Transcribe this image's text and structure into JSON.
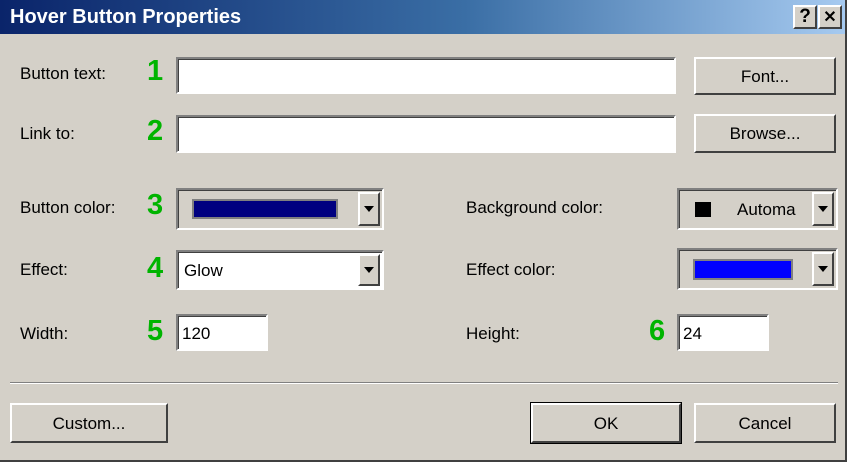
{
  "window": {
    "title": "Hover Button Properties",
    "help_label": "?",
    "close_label": "✕"
  },
  "fields": {
    "button_text": {
      "label": "Button text:",
      "number": "1",
      "value": ""
    },
    "link_to": {
      "label": "Link to:",
      "number": "2",
      "value": ""
    },
    "button_color": {
      "label": "Button color:",
      "number": "3",
      "color": "#000080"
    },
    "effect": {
      "label": "Effect:",
      "number": "4",
      "value": "Glow"
    },
    "width": {
      "label": "Width:",
      "number": "5",
      "value": "120"
    },
    "background_color": {
      "label": "Background color:",
      "value": "Automa",
      "color": "#000000"
    },
    "effect_color": {
      "label": "Effect color:",
      "color": "#0000ff"
    },
    "height": {
      "label": "Height:",
      "number": "6",
      "value": "24"
    }
  },
  "buttons": {
    "font": "Font...",
    "browse": "Browse...",
    "custom": "Custom...",
    "ok": "OK",
    "cancel": "Cancel"
  },
  "colors": {
    "dialog_bg": "#d4d0c8",
    "title_gradient_start": "#0a246a",
    "title_gradient_end": "#a6caf0",
    "annotation_number": "#00b400"
  },
  "icons": {
    "dropdown": "chevron-down-icon",
    "help": "help-icon",
    "close": "close-icon"
  }
}
